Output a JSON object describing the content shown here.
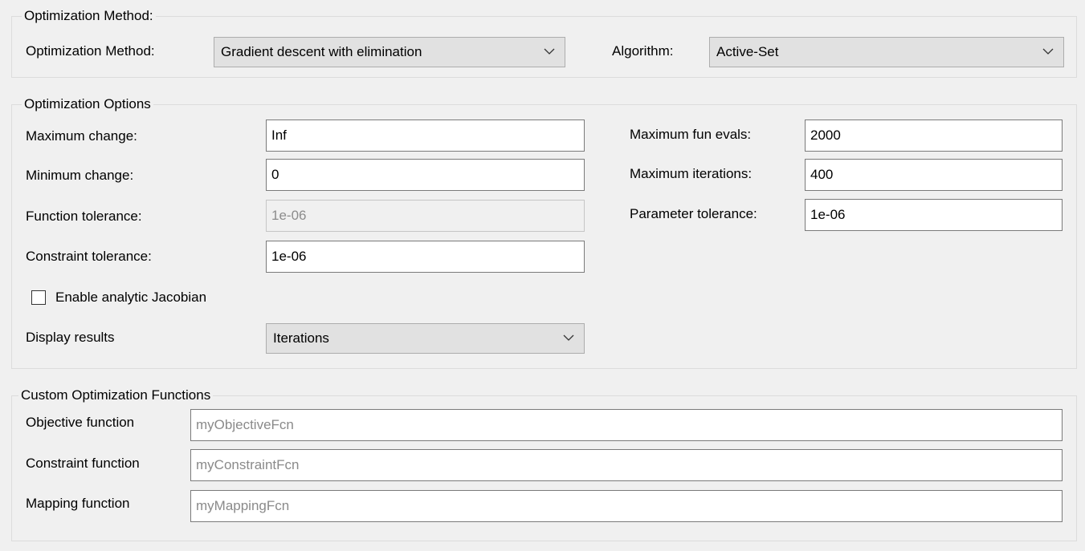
{
  "optimization_method_group": {
    "title": "Optimization Method:",
    "method_label": "Optimization Method:",
    "method_value": "Gradient descent with elimination",
    "algorithm_label": "Algorithm:",
    "algorithm_value": "Active-Set"
  },
  "optimization_options_group": {
    "title": "Optimization Options",
    "max_change_label": "Maximum change:",
    "max_change_value": "Inf",
    "min_change_label": "Minimum change:",
    "min_change_value": "0",
    "function_tolerance_label": "Function tolerance:",
    "function_tolerance_value": "1e-06",
    "constraint_tolerance_label": "Constraint tolerance:",
    "constraint_tolerance_value": "1e-06",
    "max_fun_evals_label": "Maximum fun evals:",
    "max_fun_evals_value": "2000",
    "max_iterations_label": "Maximum iterations:",
    "max_iterations_value": "400",
    "parameter_tolerance_label": "Parameter tolerance:",
    "parameter_tolerance_value": "1e-06",
    "analytic_jacobian_label": "Enable analytic Jacobian",
    "analytic_jacobian_checked": false,
    "display_results_label": "Display results",
    "display_results_value": "Iterations"
  },
  "custom_functions_group": {
    "title": "Custom Optimization Functions",
    "objective_label": "Objective function",
    "objective_placeholder": "myObjectiveFcn",
    "constraint_label": "Constraint function",
    "constraint_placeholder": "myConstraintFcn",
    "mapping_label": "Mapping function",
    "mapping_placeholder": "myMappingFcn"
  },
  "icons": {
    "dropdown": "chevron-down-icon"
  }
}
